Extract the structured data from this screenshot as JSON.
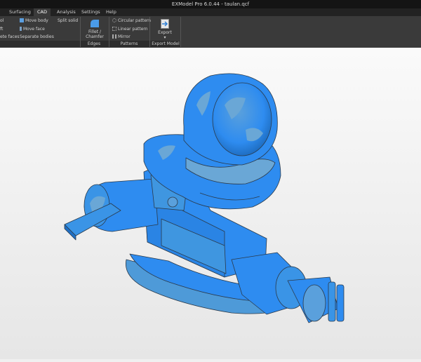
{
  "window": {
    "title": "EXModel Pro 6.0.44 - taulan.qcf"
  },
  "tabs": [
    {
      "label": "Surfacing"
    },
    {
      "label": "CAD"
    },
    {
      "label": "Analysis"
    },
    {
      "label": "Settings"
    },
    {
      "label": "Help"
    }
  ],
  "ribbon": {
    "left_partial": [
      "ol",
      "ft",
      "ete faces"
    ],
    "body_tools": [
      "Move body",
      "Move face",
      "Separate bodies"
    ],
    "split_solid": "Split solid",
    "fillet_label_1": "Fillet /",
    "fillet_label_2": "Chamfer",
    "patterns": [
      "Circular pattern",
      "Linear pattern",
      "Mirror"
    ],
    "export_label": "Export",
    "groups": {
      "edges": "Edges",
      "patterns": "Patterns",
      "export": "Export Model"
    }
  },
  "colors": {
    "model_blue": "#2e8cf0",
    "model_light": "#66a6d8",
    "ribbon": "#3a3a3a",
    "accent_icon": "#4a9be8"
  }
}
